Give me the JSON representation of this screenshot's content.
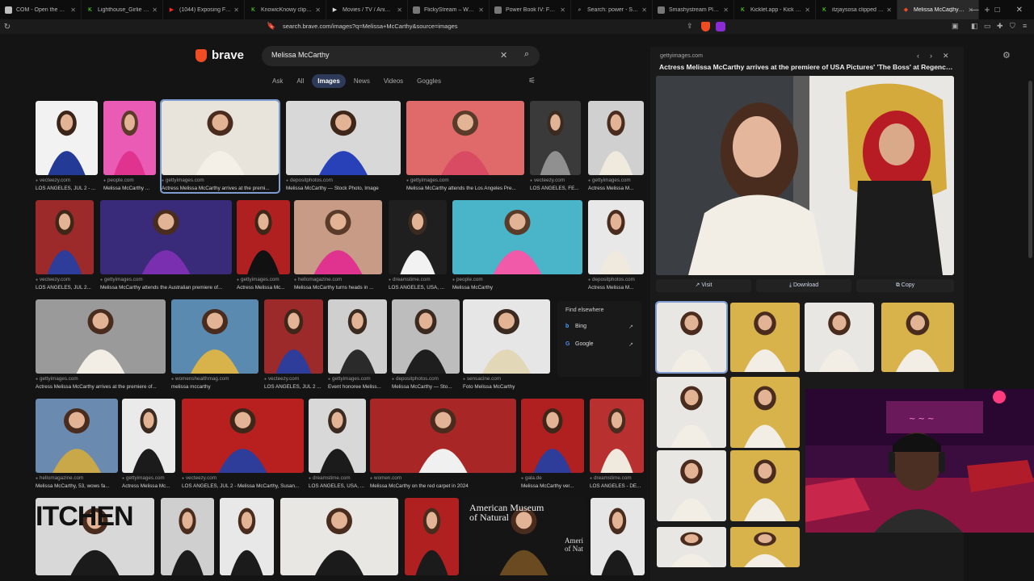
{
  "tabs": [
    {
      "label": "COM - Open the Gate",
      "icon": "tab-favicon",
      "color": "#c0c0c0",
      "glyph": ""
    },
    {
      "label": "Lighthouse_Girlie Stream -",
      "icon": "kick-icon",
      "color": "#53fc18",
      "glyph": "K"
    },
    {
      "label": "(1044) Exposing FAKE DBD",
      "icon": "youtube-icon",
      "color": "#ff2a2a",
      "glyph": "▶"
    },
    {
      "label": "KnowicKnowy clipped by it",
      "icon": "kick-icon",
      "color": "#53fc18",
      "glyph": "K"
    },
    {
      "label": "Movies / TV / Anime • free",
      "icon": "play-icon",
      "color": "#dddddd",
      "glyph": "▶"
    },
    {
      "label": "FlickyStream – Watch Movi",
      "icon": "tab-favicon",
      "color": "#777777",
      "glyph": ""
    },
    {
      "label": "Power Book IV: Force (2024",
      "icon": "tab-favicon",
      "color": "#777777",
      "glyph": ""
    },
    {
      "label": "Search: power - SmashySt",
      "icon": "search-icon",
      "color": "#bbbbbb",
      "glyph": "⌕"
    },
    {
      "label": "Smashystream Player",
      "icon": "tab-favicon",
      "color": "#777777",
      "glyph": ""
    },
    {
      "label": "Kicklet.app - Kick Chatbot",
      "icon": "kick-icon",
      "color": "#53fc18",
      "glyph": "K"
    },
    {
      "label": "itzjaysosa clipped by Quee",
      "icon": "kick-icon",
      "color": "#53fc18",
      "glyph": "K"
    },
    {
      "label": "Melissa McCarthy - Bra",
      "icon": "brave-icon",
      "color": "#f04c24",
      "glyph": "◆",
      "active": true
    }
  ],
  "address": {
    "url": "search.brave.com/images?q=Melissa+McCarthy&source=images"
  },
  "brand": {
    "name": "brave",
    "accent": "#f04c24"
  },
  "search": {
    "query": "Melissa McCarthy"
  },
  "navtabs": [
    "Ask",
    "All",
    "Images",
    "News",
    "Videos",
    "Goggles"
  ],
  "results": [
    {
      "src": "vecteezy.com",
      "title": "LOS ANGELES, JUL 2 - ..."
    },
    {
      "src": "people.com",
      "title": "Melissa McCarthy ..."
    },
    {
      "src": "gettyimages.com",
      "title": "Actress Melissa McCarthy arrives at the premi..."
    },
    {
      "src": "depositphotos.com",
      "title": "Melissa McCarthy — Stock Photo, Image"
    },
    {
      "src": "gettyimages.com",
      "title": "Melissa McCarthy attends the Los Angeles Pre..."
    },
    {
      "src": "vecteezy.com",
      "title": "LOS ANGELES, FE..."
    },
    {
      "src": "gettyimages.com",
      "title": "Actress Melissa M..."
    },
    {
      "src": "vecteezy.com",
      "title": "LOS ANGELES, JUL 2..."
    },
    {
      "src": "gettyimages.com",
      "title": "Melissa McCarthy attends the Australian premiere of..."
    },
    {
      "src": "gettyimages.com",
      "title": "Actress Melissa Mc..."
    },
    {
      "src": "hellomagazine.com",
      "title": "Melissa McCarthy turns heads in ..."
    },
    {
      "src": "dreamstime.com",
      "title": "LOS ANGELES, USA, ..."
    },
    {
      "src": "people.com",
      "title": "Melissa McCarthy"
    },
    {
      "src": "depositphotos.com",
      "title": "Actress Melissa M..."
    },
    {
      "src": "gettyimages.com",
      "title": "Actress Melissa McCarthy arrives at the premiere of..."
    },
    {
      "src": "womenshealthmag.com",
      "title": "melissa mccarthy"
    },
    {
      "src": "vecteezy.com",
      "title": "LOS ANGELES, JUL 2 ..."
    },
    {
      "src": "gettyimages.com",
      "title": "Event honoree Meliss..."
    },
    {
      "src": "depositphotos.com",
      "title": "Melissa McCarthy — Sto..."
    },
    {
      "src": "sensacine.com",
      "title": "Foto Melissa McCarthy"
    },
    {
      "src": "hellomagazine.com",
      "title": "Melissa McCarthy, 53, wows fa..."
    },
    {
      "src": "gettyimages.com",
      "title": "Actress Melissa Mc..."
    },
    {
      "src": "vecteezy.com",
      "title": "LOS ANGELES, JUL 2 - Melissa McCarthy, Susan..."
    },
    {
      "src": "dreamstime.com",
      "title": "LOS ANGELES, USA, ..."
    },
    {
      "src": "women.com",
      "title": "Melissa McCarthy on the red carpet in 2024"
    },
    {
      "src": "gala.de",
      "title": "Melissa McCarthy ver..."
    },
    {
      "src": "dreamstime.com",
      "title": "LOS ANGELES - DE..."
    }
  ],
  "find_elsewhere": {
    "heading": "Find elsewhere",
    "items": [
      {
        "label": "Bing",
        "icon": "bing-icon"
      },
      {
        "label": "Google",
        "icon": "google-icon"
      }
    ]
  },
  "bottom_row_text": {
    "kitchen": "ITCHEN",
    "museum": "American Museum of Natural",
    "museum_small": "Ameri of Nat"
  },
  "preview": {
    "src": "gettyimages.com",
    "title": "Actress Melissa McCarthy arrives at the premiere of USA Pictures' 'The Boss' at Regency...",
    "actions": {
      "visit": "Visit",
      "download": "Download",
      "copy": "Copy"
    }
  }
}
